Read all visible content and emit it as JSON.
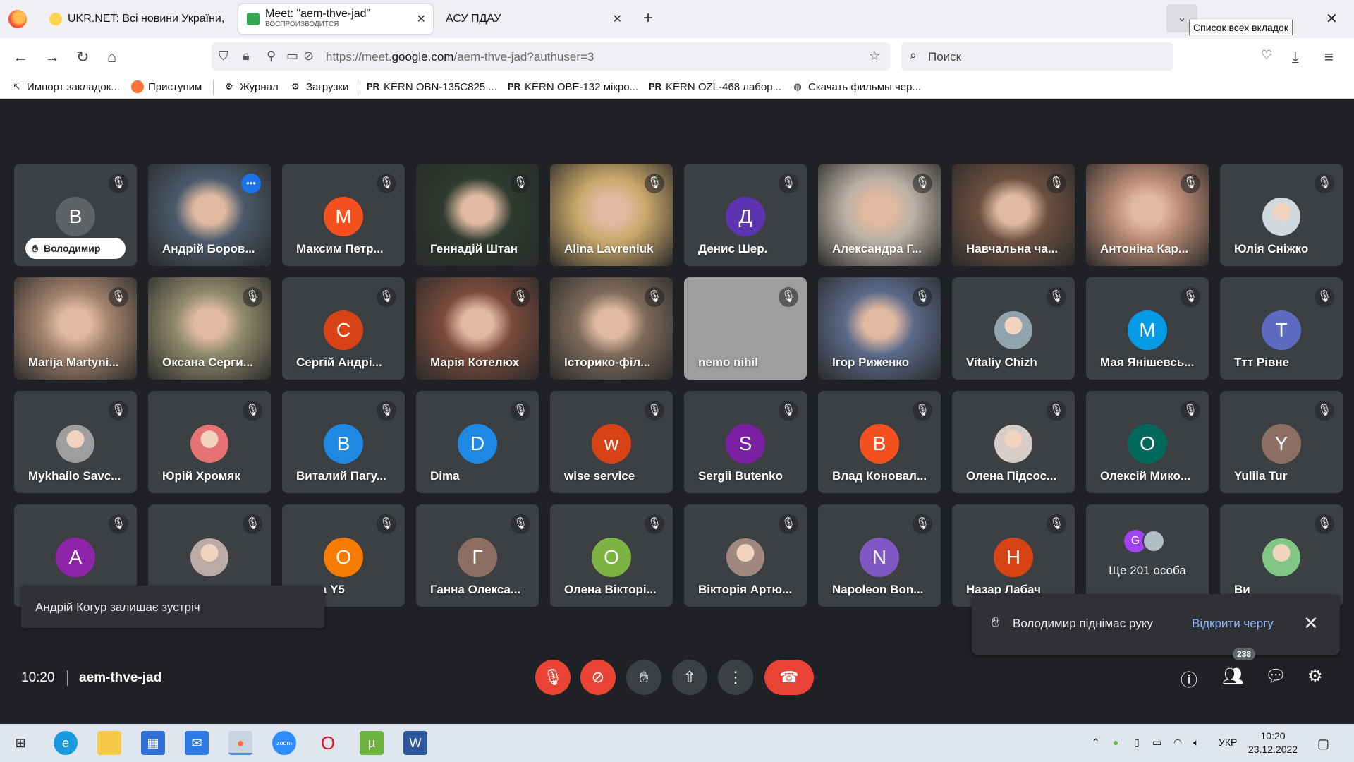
{
  "browser": {
    "tabs": [
      {
        "title": "UKR.NET: Всі новини України,",
        "subtitle": "",
        "active": false
      },
      {
        "title": "Meet: \"aem-thve-jad\"",
        "subtitle": "ВОСПРОИЗВОДИТСЯ",
        "active": true
      },
      {
        "title": "АСУ ПДАУ",
        "subtitle": "",
        "active": false
      }
    ],
    "new_tab": "+",
    "all_tabs_tooltip": "Список всех вкладок",
    "url_prefix": "https://meet.",
    "url_domain": "google.com",
    "url_path": "/aem-thve-jad?authuser=3",
    "search_placeholder": "Поиск",
    "bookmarks": [
      {
        "label": "Импорт закладок...",
        "icon": "import-icon"
      },
      {
        "label": "Приступим",
        "icon": "firefox-icon"
      },
      {
        "label": "Журнал",
        "icon": "gear-icon"
      },
      {
        "label": "Загрузки",
        "icon": "gear-icon"
      },
      {
        "label": "KERN OBN-135C825 ...",
        "icon": "pr-icon"
      },
      {
        "label": "KERN OBE-132 мікро...",
        "icon": "pr-icon"
      },
      {
        "label": "KERN OZL-468 лабор...",
        "icon": "pr-icon"
      },
      {
        "label": "Скачать фильмы чер...",
        "icon": "globe-icon"
      }
    ]
  },
  "meet": {
    "participants": [
      {
        "name": "Володимир",
        "type": "letter",
        "letter": "В",
        "color": "#5f6368",
        "hand_raised": true
      },
      {
        "name": "Андрій Боров...",
        "type": "video",
        "color": "#4a5a6a",
        "speaking": true
      },
      {
        "name": "Максим Петр...",
        "type": "letter",
        "letter": "М",
        "color": "#f4511e"
      },
      {
        "name": "Геннадій Штан",
        "type": "video",
        "color": "#2e3b2f"
      },
      {
        "name": "Alina Lavreniuk",
        "type": "video",
        "color": "#c9a86a"
      },
      {
        "name": "Денис Шер.",
        "type": "letter",
        "letter": "Д",
        "color": "#5e35b1"
      },
      {
        "name": "Александра Г...",
        "type": "video",
        "color": "#b9b1a5"
      },
      {
        "name": "Навчальна ча...",
        "type": "video",
        "color": "#6b4f3f"
      },
      {
        "name": "Антоніна Кар...",
        "type": "video",
        "color": "#b98a74"
      },
      {
        "name": "Юлія Сніжко",
        "type": "photo",
        "color": "#cfd8dc"
      },
      {
        "name": "Marija Martyni...",
        "type": "video",
        "color": "#a2826b"
      },
      {
        "name": "Оксана Серги...",
        "type": "video",
        "color": "#8d8a6a"
      },
      {
        "name": "Сергій Андрі...",
        "type": "letter",
        "letter": "С",
        "color": "#d84315"
      },
      {
        "name": "Марія Котелюх",
        "type": "video",
        "color": "#7a4b3b"
      },
      {
        "name": "Історико-філ...",
        "type": "video",
        "color": "#7d6a5a"
      },
      {
        "name": "nemo nihil",
        "type": "plain",
        "color": "#9e9e9e"
      },
      {
        "name": "Ігор Риженко",
        "type": "video",
        "color": "#5b6a8a"
      },
      {
        "name": "Vitaliy Chizh",
        "type": "photo",
        "color": "#90a4ae"
      },
      {
        "name": "Мая Янішевсь...",
        "type": "letter",
        "letter": "М",
        "color": "#039be5"
      },
      {
        "name": "Ттт Рівне",
        "type": "letter",
        "letter": "Т",
        "color": "#5c6bc0"
      },
      {
        "name": "Mykhailo Savc...",
        "type": "photo",
        "color": "#9e9e9e"
      },
      {
        "name": "Юрій Хромяк",
        "type": "photo",
        "color": "#e57373"
      },
      {
        "name": "Виталий Пагу...",
        "type": "letter",
        "letter": "В",
        "color": "#1e88e5"
      },
      {
        "name": "Dima",
        "type": "letter",
        "letter": "D",
        "color": "#1e88e5"
      },
      {
        "name": "wise service",
        "type": "letter",
        "letter": "w",
        "color": "#d84315"
      },
      {
        "name": "Sergii Butenko",
        "type": "letter",
        "letter": "S",
        "color": "#7b1fa2"
      },
      {
        "name": "Влад Коновал...",
        "type": "letter",
        "letter": "В",
        "color": "#f4511e"
      },
      {
        "name": "Олена Підсос...",
        "type": "photo",
        "color": "#d7ccc8"
      },
      {
        "name": "Олексій Мико...",
        "type": "letter",
        "letter": "О",
        "color": "#00695c"
      },
      {
        "name": "Yuliia Tur",
        "type": "letter",
        "letter": "Y",
        "color": "#8d6e63"
      },
      {
        "name": "",
        "type": "letter",
        "letter": "А",
        "color": "#8e24aa"
      },
      {
        "name": "",
        "type": "photo",
        "color": "#bcaaa4"
      },
      {
        "name": "...ана Y5",
        "type": "letter",
        "letter": "О",
        "color": "#f57c00"
      },
      {
        "name": "Ганна Олекса...",
        "type": "letter",
        "letter": "Г",
        "color": "#8d6e63"
      },
      {
        "name": "Олена Вікторі...",
        "type": "letter",
        "letter": "О",
        "color": "#7cb342"
      },
      {
        "name": "Вікторія Артю...",
        "type": "photo",
        "color": "#a1887f"
      },
      {
        "name": "Napoleon Bon...",
        "type": "letter",
        "letter": "N",
        "color": "#7e57c2"
      },
      {
        "name": "Назар Лабач",
        "type": "letter",
        "letter": "Н",
        "color": "#d84315"
      },
      {
        "name": "Ще 201 особа",
        "type": "more",
        "letter": "G",
        "color": "#a142f4"
      },
      {
        "name": "Ви",
        "type": "photo",
        "color": "#81c784"
      }
    ],
    "toast": "Андрій Когур залишає зустріч",
    "hand_notification": {
      "message": "Володимир піднімає руку",
      "action": "Відкрити чергу"
    },
    "bottom": {
      "time": "10:20",
      "meeting_code": "aem-thve-jad",
      "participant_count": "238"
    }
  },
  "taskbar": {
    "lang": "УКР",
    "time": "10:20",
    "date": "23.12.2022"
  }
}
